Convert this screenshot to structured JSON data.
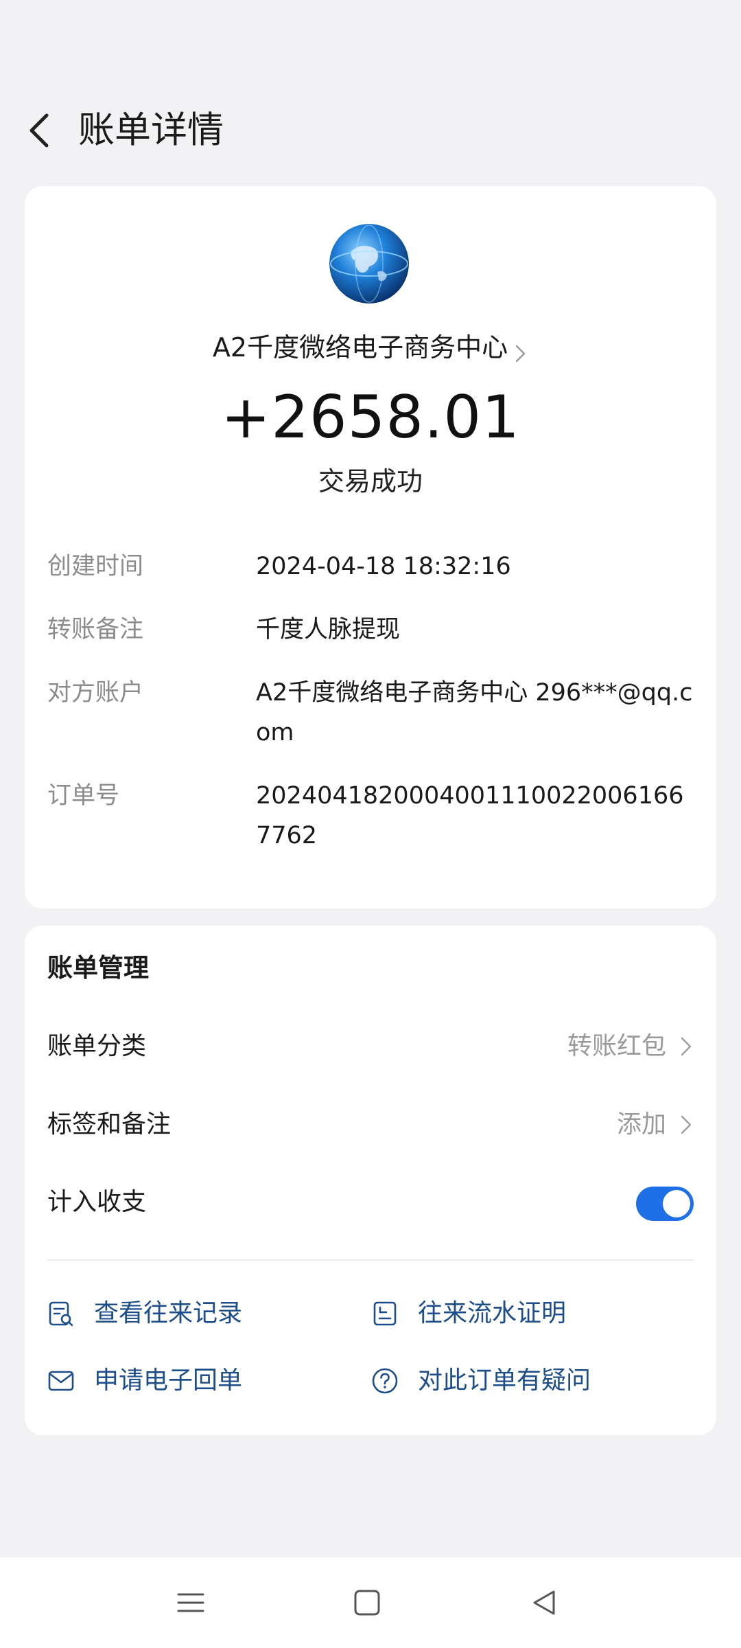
{
  "header": {
    "title": "账单详情"
  },
  "summary": {
    "merchant_name": "A2千度微络电子商务中心",
    "amount": "+2658.01",
    "status": "交易成功"
  },
  "details": [
    {
      "label": "创建时间",
      "value": "2024-04-18 18:32:16"
    },
    {
      "label": "转账备注",
      "value": "千度人脉提现"
    },
    {
      "label": "对方账户",
      "value": "A2千度微络电子商务中心 296***@qq.com"
    },
    {
      "label": "订单号",
      "value": "20240418200040011100220061667762"
    }
  ],
  "management": {
    "title": "账单管理",
    "category": {
      "label": "账单分类",
      "value": "转账红包"
    },
    "tags": {
      "label": "标签和备注",
      "value": "添加"
    },
    "include": {
      "label": "计入收支",
      "enabled": true
    }
  },
  "actions": [
    {
      "label": "查看往来记录",
      "icon": "records-search-icon"
    },
    {
      "label": "往来流水证明",
      "icon": "statement-proof-icon"
    },
    {
      "label": "申请电子回单",
      "icon": "envelope-icon"
    },
    {
      "label": "对此订单有疑问",
      "icon": "question-circle-icon"
    }
  ],
  "colors": {
    "accent": "#1f6fe6",
    "action_text": "#1d4e8a",
    "background": "#f2f2f4",
    "label_gray": "#8c8c8c"
  },
  "icons": {
    "back": "chevron-left-icon",
    "chevron": "chevron-right-icon",
    "avatar": "globe-logo-avatar",
    "nav": [
      "menu-icon",
      "home-square-icon",
      "back-triangle-icon"
    ]
  }
}
